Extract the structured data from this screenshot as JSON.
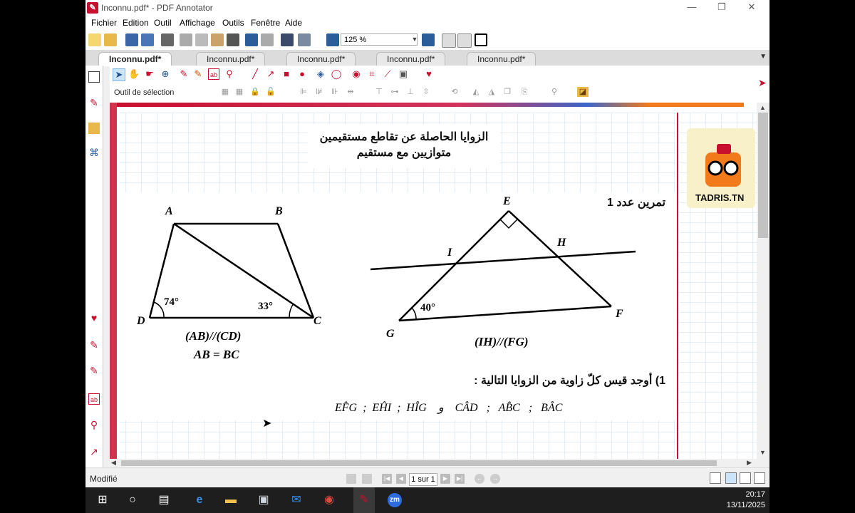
{
  "window": {
    "title": "Inconnu.pdf* - PDF Annotator"
  },
  "menus": [
    "Fichier",
    "Edition",
    "Outil",
    "Affichage",
    "Outils",
    "Fenêtre",
    "Aide"
  ],
  "toolbar": {
    "zoom": "125 %"
  },
  "tabs": [
    "Inconnu.pdf*",
    "Inconnu.pdf*",
    "Inconnu.pdf*",
    "Inconnu.pdf*",
    "Inconnu.pdf*"
  ],
  "annotation_toolbar": {
    "tool_label": "Outil de sélection"
  },
  "document": {
    "title_line1": "الزوايا الحاصلة عن تقاطع مستقيمين",
    "title_line2": "متوازيين مع مستقيم",
    "logo_text": "TADRIS.TN",
    "exercise_label": "تمرين عدد 1",
    "fig1": {
      "A": "A",
      "B": "B",
      "C": "C",
      "D": "D",
      "angle_d": "74°",
      "angle_c": "33°",
      "caption1": "(AB)//(CD)",
      "caption2": "AB = BC"
    },
    "fig2": {
      "E": "E",
      "F": "F",
      "G": "G",
      "H": "H",
      "I": "I",
      "angle_g": "40°",
      "caption": "(IH)//(FG)"
    },
    "question": "1) أوجد قيس كلّ زاوية من الزوايا التالية :",
    "angles_list": "EF̂G  ;  EĤI  ;  HÎG    و    CÂD   ;   AB̂C   ;   BÂC"
  },
  "status": {
    "text": "Modifié",
    "page": "1 sur 1"
  },
  "taskbar": {
    "time": "20:17",
    "date": "13/11/2025"
  }
}
